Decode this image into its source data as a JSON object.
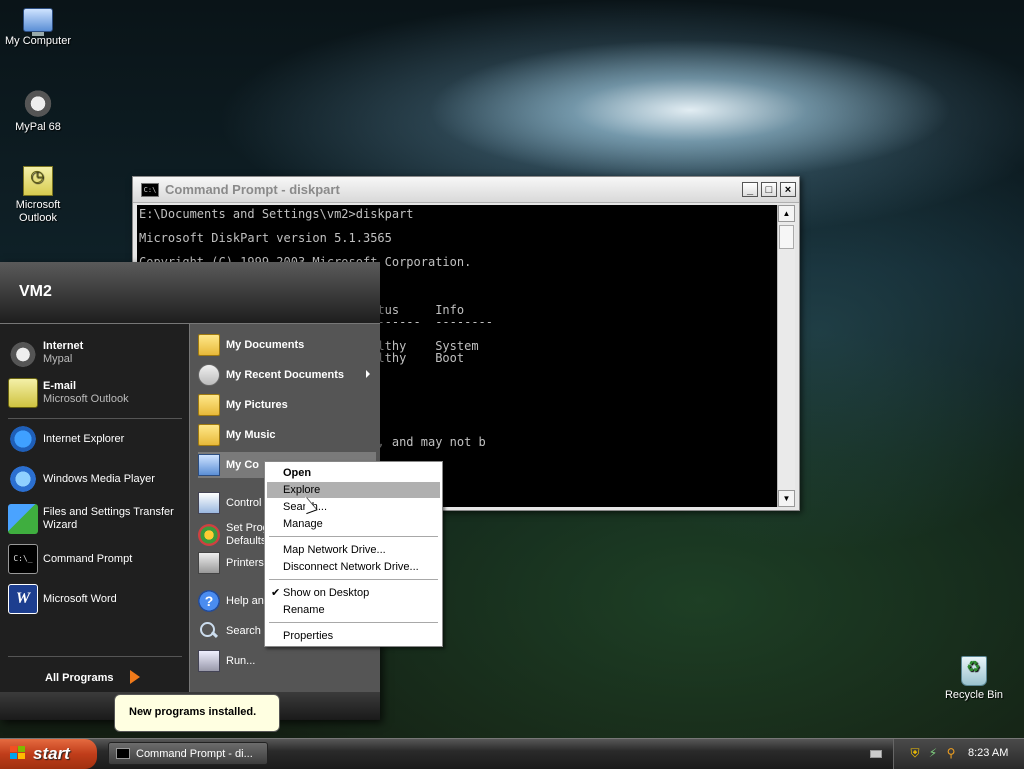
{
  "desktop": {
    "icons": [
      {
        "label": "My Computer",
        "icon": "my-computer-icon"
      },
      {
        "label": "MyPal 68",
        "icon": "mypal-icon"
      },
      {
        "label": "Microsoft Outlook",
        "icon": "outlook-icon"
      },
      {
        "label": "Recycle Bin",
        "icon": "recycle-bin-icon"
      }
    ]
  },
  "cmd_window": {
    "title": "Command Prompt - diskpart",
    "lines": [
      "E:\\Documents and Settings\\vm2>diskpart",
      "",
      "Microsoft DiskPart version 5.1.3565",
      "",
      "Copyright (C) 1999-2003 Microsoft Corporation.",
      "",
      "",
      "",
      "  Fs     Type        Size     Status     Info",
      "  -----  ----------  -------  ---------  --------",
      "         CD-ROM          0 B",
      "  NTFS   Partition     40 GB  Healthy    System",
      "  NTFS   Partition     40 GB  Healthy    Boot",
      "",
      "",
      "e.",
      "",
      "",
      "",
      "   the operation of your computer, and may not b"
    ],
    "minimize": "_",
    "maximize": "□",
    "close": "×"
  },
  "start_menu": {
    "user": "VM2",
    "pinned": [
      {
        "main": "Internet",
        "sub": "Mypal"
      },
      {
        "main": "E-mail",
        "sub": "Microsoft Outlook"
      }
    ],
    "recent": [
      "Internet Explorer",
      "Windows Media Player",
      "Files and Settings Transfer Wizard",
      "Command Prompt",
      "Microsoft Word"
    ],
    "all_programs": "All Programs",
    "right": [
      "My Documents",
      "My Recent Documents",
      "My Pictures",
      "My Music",
      "My Co",
      "Control",
      "Set Prog Defaults",
      "Printers",
      "Help and",
      "Search",
      "Run..."
    ]
  },
  "context_menu": {
    "items": [
      "Open",
      "Explore",
      "Search...",
      "Manage",
      "Map Network Drive...",
      "Disconnect Network Drive...",
      "Show on Desktop",
      "Rename",
      "Properties"
    ],
    "selected": "Explore"
  },
  "balloon": {
    "text": "New programs installed."
  },
  "taskbar": {
    "start_label": "start",
    "task": "Command Prompt - di...",
    "clock": "8:23 AM"
  },
  "colors": {
    "start_button": "#c03d1a",
    "menu_highlight": "#7a7a7a",
    "context_selected": "#b0b0b0",
    "balloon": "#ffffe1"
  }
}
